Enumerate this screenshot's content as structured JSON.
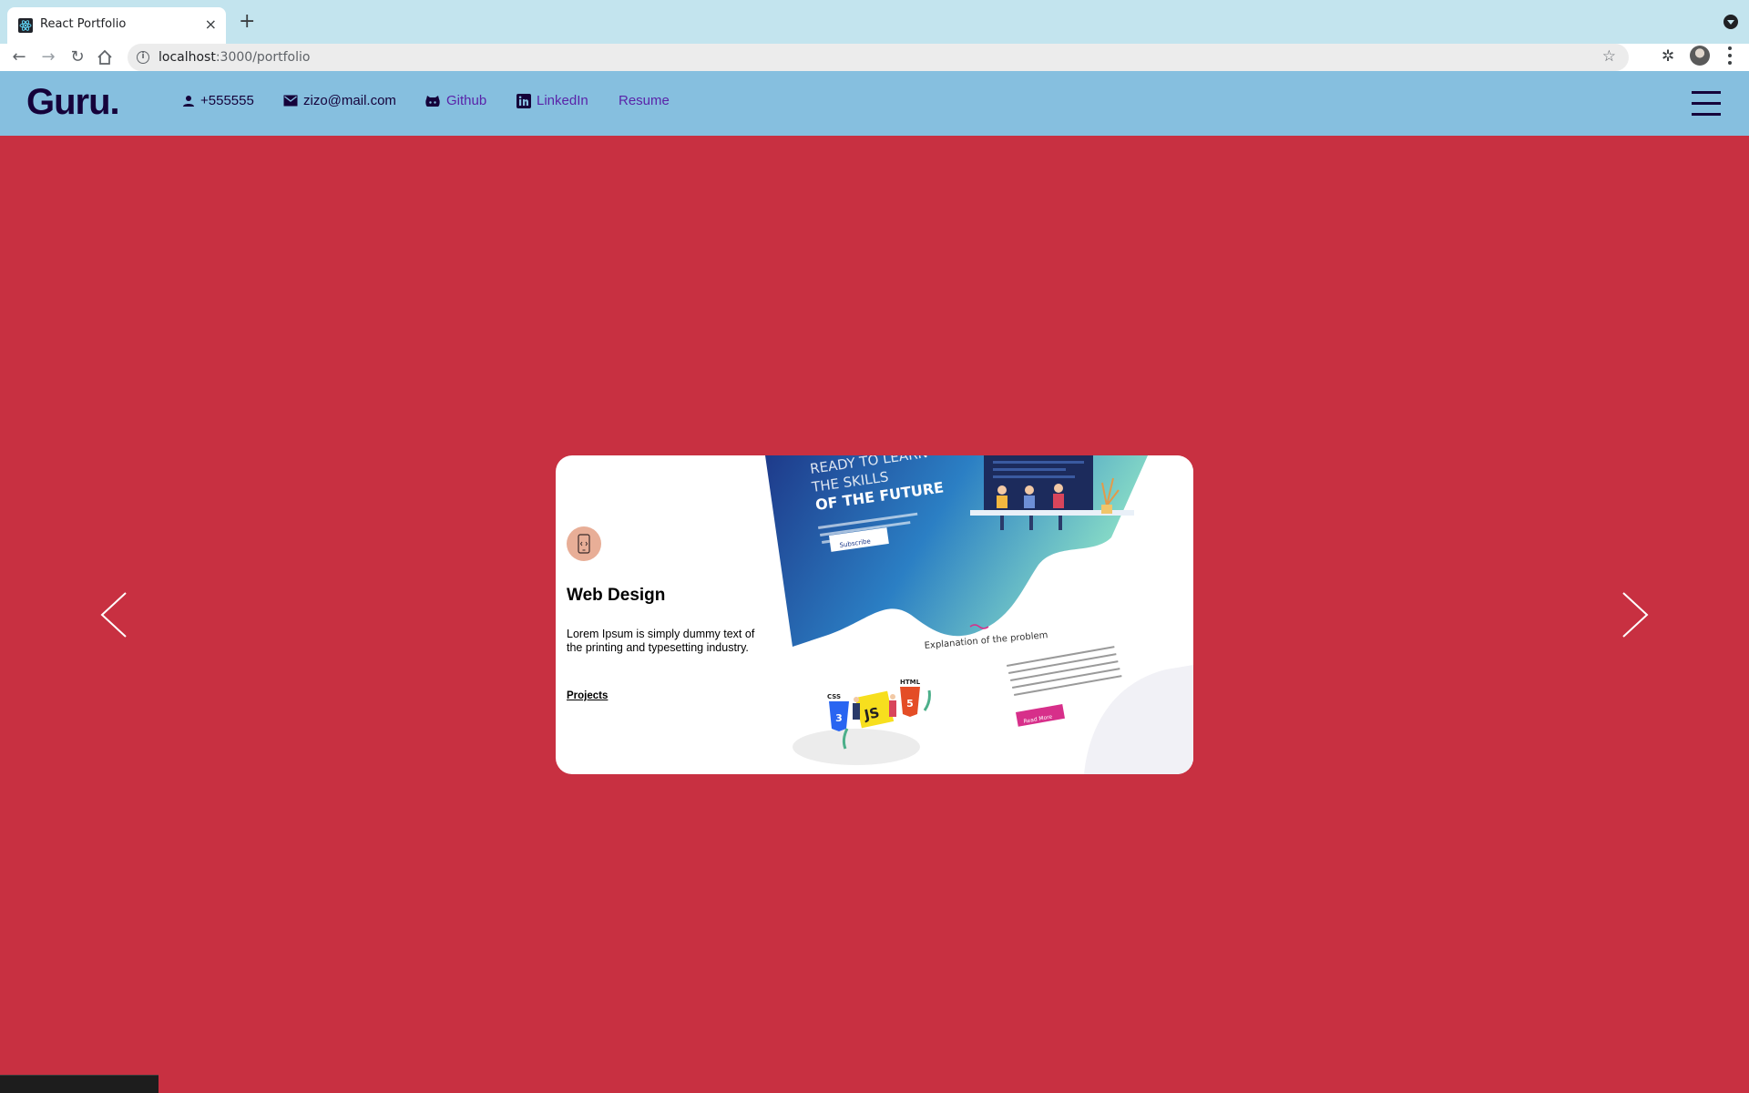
{
  "browser": {
    "tab_title": "React Portfolio",
    "close_glyph": "×",
    "new_tab_glyph": "+",
    "url_host": "localhost",
    "url_path": ":3000/portfolio",
    "star_glyph": "☆",
    "extensions_glyph": "✲"
  },
  "header": {
    "logo": "Guru.",
    "phone": "+555555",
    "email": "zizo@mail.com",
    "github": "Github",
    "linkedin": "LinkedIn",
    "resume": "Resume"
  },
  "slider": {
    "card": {
      "icon": "mobile-code-icon",
      "title": "Web Design",
      "description": "Lorem Ipsum is simply dummy text of the printing and typesetting industry.",
      "link": "Projects",
      "mockup": {
        "headline_1": "READY TO LEARN",
        "headline_2": "THE SKILLS",
        "headline_3": "OF THE FUTURE",
        "subscribe": "Subscribe",
        "section_title": "Explanation of the problem",
        "read_more": "Read More",
        "badges": [
          "CSS",
          "JS",
          "HTML"
        ]
      }
    }
  },
  "colors": {
    "page_bg": "#c83041",
    "header_bg": "#86bfdf",
    "logo": "#15023a",
    "link": "#5a23a8",
    "card_bg": "#ffffff"
  }
}
